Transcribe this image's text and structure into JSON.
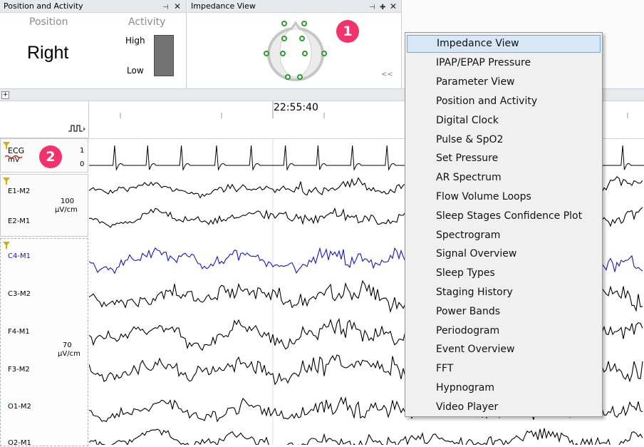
{
  "panels": {
    "position_activity": {
      "title": "Position and Activity",
      "position_header": "Position",
      "activity_header": "Activity",
      "position_value": "Right",
      "activity_high": "High",
      "activity_low": "Low"
    },
    "impedance": {
      "title": "Impedance View",
      "collapse_glyph": "<<"
    }
  },
  "timeline": {
    "time_label": "22:55:40"
  },
  "channels": {
    "ecg": {
      "name": "ECG",
      "unit": "mV",
      "scale_top": "1",
      "scale_bottom": "0"
    },
    "eog": {
      "ch1": "E1-M2",
      "ch2": "E2-M1",
      "scale_value": "100",
      "scale_unit": "µV/cm"
    },
    "eeg": {
      "ch1": "C4-M1",
      "ch2": "C3-M2",
      "ch3": "F4-M1",
      "ch4": "F3-M2",
      "ch5": "O1-M2",
      "ch6": "O2-M1",
      "scale_value": "70",
      "scale_unit": "µV/cm"
    }
  },
  "badges": {
    "one": "1",
    "two": "2"
  },
  "context_menu": {
    "items": [
      "Impedance View",
      "IPAP/EPAP Pressure",
      "Parameter View",
      "Position and Activity",
      "Digital Clock",
      "Pulse & SpO2",
      "Set Pressure",
      "AR Spectrum",
      "Flow Volume Loops",
      "Sleep Stages Confidence Plot",
      "Spectrogram",
      "Signal Overview",
      "Sleep Types",
      "Staging History",
      "Power Bands",
      "Periodogram",
      "Event Overview",
      "FFT",
      "Hypnogram",
      "Video Player"
    ],
    "highlighted_index": 0
  },
  "colors": {
    "accent_badge": "#f0336b",
    "highlight_trace": "#1515c8",
    "electrode_green": "#2e9b2e",
    "menu_highlight": "#d6e8f8"
  }
}
